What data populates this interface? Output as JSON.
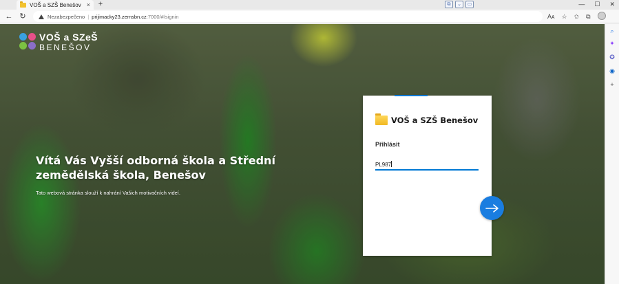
{
  "browser": {
    "tab_title": "VOŠ a SZŠ Benešov",
    "tab_close": "×",
    "new_tab": "+",
    "security_label": "Nezabezpečeno",
    "url_host": "prijimacky23.zemsbn.cz",
    "url_rest": ":7000/#/signin",
    "back": "←",
    "reload": "↻",
    "win_min": "—",
    "win_max": "☐",
    "win_close": "✕",
    "toolbar_icons": [
      "Aᴀ",
      "☆",
      "✩",
      "⧉",
      "≡"
    ],
    "sidebar_icons": [
      {
        "name": "search-icon",
        "glyph": "⌕",
        "color": "#1a73e8"
      },
      {
        "name": "copilot-icon",
        "glyph": "✦",
        "color": "#8a3ffc"
      },
      {
        "name": "games-icon",
        "glyph": "✪",
        "color": "#5b5fc7"
      },
      {
        "name": "outlook-icon",
        "glyph": "◉",
        "color": "#0a64c8"
      },
      {
        "name": "add-icon",
        "glyph": "+",
        "color": "#555555"
      }
    ]
  },
  "logo": {
    "line1": "VOŠ a SZeŠ",
    "line2": "BENEŠOV",
    "dot_colors": [
      "#3aa0e0",
      "#e8508a",
      "#7cc242",
      "#8a6ec8"
    ]
  },
  "hero": {
    "heading": "Vítá Vás Vyšší odborná škola a Střední zemědělská škola, Benešov",
    "subtext": "Tato webová stránka slouží k nahrání Vašich motivačních videí."
  },
  "login": {
    "title": "VOŠ a SZŠ Benešov",
    "signin_label": "Přihlásit",
    "input_value": "PL987",
    "accent_color": "#0078d4",
    "button_color": "#1a7de0"
  }
}
